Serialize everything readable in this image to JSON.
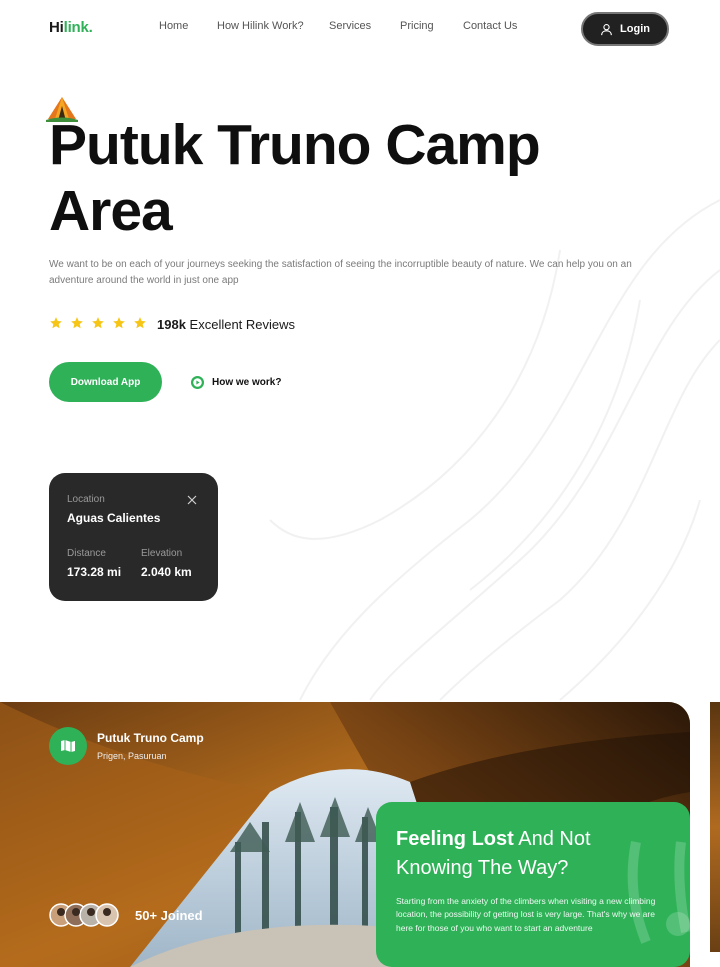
{
  "brand": {
    "name_main": "Hi",
    "name_accent": "link."
  },
  "nav": {
    "items": [
      {
        "label": "Home"
      },
      {
        "label": "How Hilink Work?"
      },
      {
        "label": "Services"
      },
      {
        "label": "Pricing"
      },
      {
        "label": "Contact Us"
      }
    ],
    "login_label": "Login"
  },
  "hero": {
    "title": "Putuk Truno Camp Area",
    "description": "We want to be on each of your journeys seeking the satisfaction of seeing the incorruptible beauty of nature. We can help you on an adventure around the world in just one app",
    "rating_stars": 5,
    "reviews_count": "198k",
    "reviews_text": "Excellent Reviews",
    "download_label": "Download App",
    "how_label": "How we work?"
  },
  "location_card": {
    "location_label": "Location",
    "location_value": "Aguas Calientes",
    "distance_label": "Distance",
    "distance_value": "173.28 mi",
    "elevation_label": "Elevation",
    "elevation_value": "2.040 km"
  },
  "camp": {
    "name": "Putuk Truno Camp",
    "place": "Prigen, Pasuruan",
    "joined": "50+ Joined"
  },
  "feature_card": {
    "title_bold": "Feeling Lost",
    "title_rest": " And Not Knowing The Way?",
    "text": "Starting from the anxiety of the climbers when visiting a new climbing location, the possibility of getting lost is very large. That's why we are here for those of you who want to start an adventure"
  },
  "colors": {
    "accent": "#2fb158",
    "dark": "#292929",
    "star": "#f6c516"
  },
  "icons": [
    "camp-tent-icon",
    "user-icon",
    "star-icon",
    "play-icon",
    "close-icon",
    "map-icon"
  ]
}
